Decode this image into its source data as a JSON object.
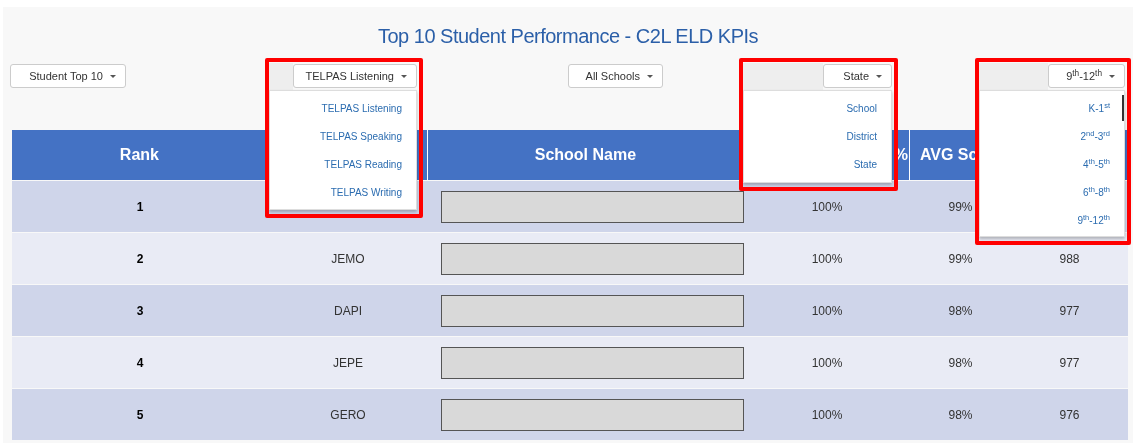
{
  "title": "Top 10 Student Performance - C2L ELD KPIs",
  "filters": [
    {
      "label": "Student Top 10",
      "open": false,
      "highlighted": false
    },
    {
      "label": "TELPAS Listening",
      "open": true,
      "highlighted": true,
      "options": [
        "TELPAS Listening",
        "TELPAS Speaking",
        "TELPAS Reading",
        "TELPAS Writing"
      ]
    },
    {
      "label": "All Schools",
      "open": false,
      "highlighted": false
    },
    {
      "label": "State",
      "open": true,
      "highlighted": true,
      "options": [
        "School",
        "District",
        "State"
      ]
    },
    {
      "label": "9$^{th}$-12$^{th}$",
      "open": true,
      "highlighted": true,
      "scrollbar": true,
      "options": [
        "K-1$^{st}$",
        "2$^{nd}$-3$^{rd}$",
        "4$^{th}$-5$^{th}$",
        "6$^{th}$-8$^{th}$",
        "9$^{th}$-12$^{th}$"
      ]
    }
  ],
  "table": {
    "columns": [
      "Rank",
      "",
      "School Name",
      "%",
      "AVG Sc",
      ""
    ],
    "rows": [
      {
        "rank": "1",
        "column_4": "100%",
        "column_5": "99%"
      },
      {
        "rank": "2",
        "column_2": "JEMO",
        "column_4": "100%",
        "column_5": "99%",
        "column_6": "988"
      },
      {
        "rank": "3",
        "column_2": "DAPI",
        "column_4": "100%",
        "column_5": "98%",
        "column_6": "977"
      },
      {
        "rank": "4",
        "column_2": "JEPE",
        "column_4": "100%",
        "column_5": "98%",
        "column_6": "977"
      },
      {
        "rank": "5",
        "column_2": "GERO",
        "column_4": "100%",
        "column_5": "98%",
        "column_6": "976"
      }
    ]
  }
}
